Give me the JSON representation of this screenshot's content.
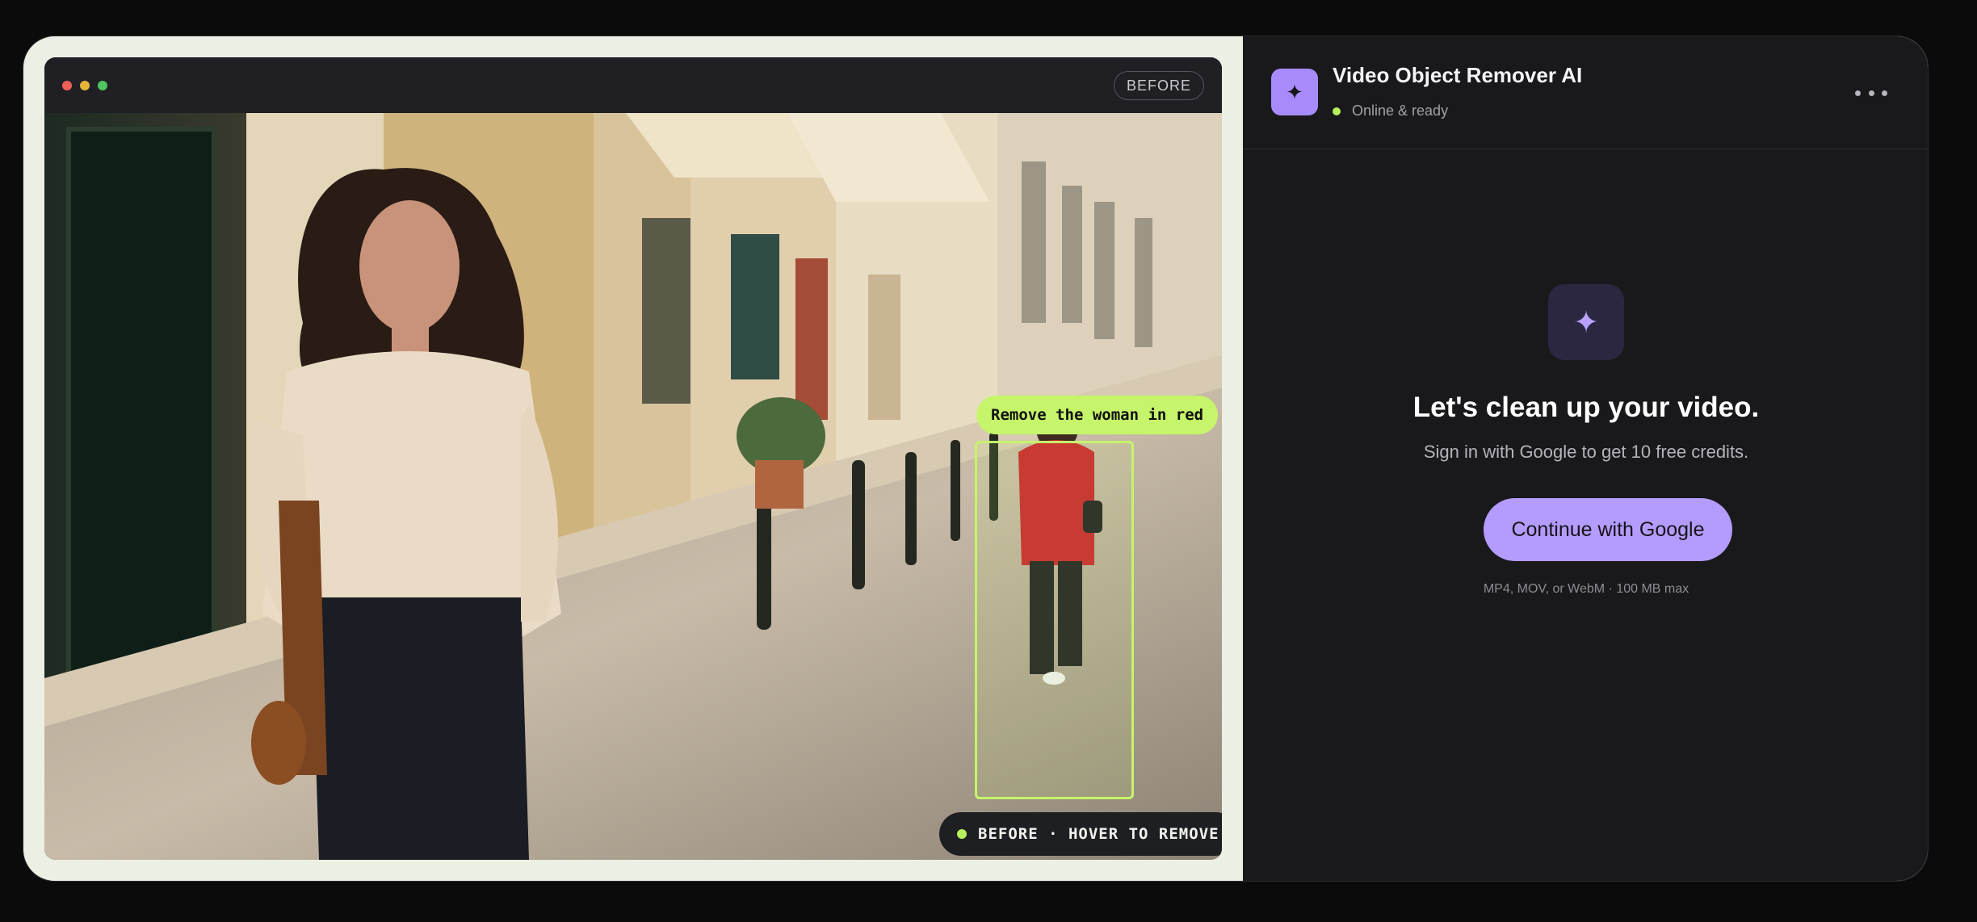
{
  "preview": {
    "window_controls": [
      "close",
      "minimize",
      "zoom"
    ],
    "before_badge": "BEFORE",
    "prompt_chip": "Remove the woman in red",
    "status_pill": "BEFORE · HOVER TO REMOVE",
    "scene_description_icon": "street-photo"
  },
  "panel": {
    "app_title": "Video Object Remover AI",
    "app_icon": "sparkle-icon",
    "status": "Online & ready",
    "more_icon": "more-horizontal-icon",
    "hero_icon": "sparkle-icon",
    "headline": "Let's clean up your video.",
    "subline": "Sign in with Google to get 10 free credits.",
    "cta_label": "Continue with Google",
    "fineprint": "MP4, MOV, or WebM · 100 MB max"
  },
  "colors": {
    "accent_lime": "#c6f46a",
    "accent_purple": "#b49cff",
    "panel_bg": "#19191c"
  }
}
